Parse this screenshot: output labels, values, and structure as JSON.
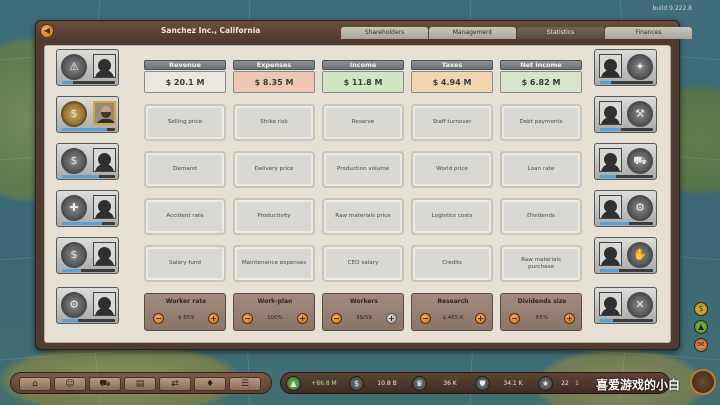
{
  "version": "build 9.222.8",
  "window": {
    "title": "Sanchez Inc., California",
    "close_icon": "back-arrow-icon"
  },
  "tabs": [
    {
      "label": "Shareholders",
      "active": false
    },
    {
      "label": "Management",
      "active": false
    },
    {
      "label": "Statistics",
      "active": true
    },
    {
      "label": "Finances",
      "active": false
    }
  ],
  "headers": [
    {
      "label": "Revenue",
      "value": "$ 20.1 M"
    },
    {
      "label": "Expenses",
      "value": "$ 8.35 M"
    },
    {
      "label": "Income",
      "value": "$ 11.8 M"
    },
    {
      "label": "Taxes",
      "value": "$ 4.94 M"
    },
    {
      "label": "Net income",
      "value": "$ 6.82 M"
    }
  ],
  "factors": [
    [
      "Selling price",
      "Strike risk",
      "Reserve",
      "Staff turnover",
      "Debt payments"
    ],
    [
      "Demand",
      "Delivery price",
      "Production volume",
      "World price",
      "Loan rate"
    ],
    [
      "Accident rate",
      "Productivity",
      "Raw materials price",
      "Logistics costs",
      "Dividends"
    ],
    [
      "Salary fund",
      "Maintenance expenses",
      "CEO salary",
      "Credits",
      "Raw materials purchase"
    ]
  ],
  "controls": [
    {
      "label": "Worker rate",
      "value": "$ 659"
    },
    {
      "label": "Work-plan",
      "value": "100%"
    },
    {
      "label": "Workers",
      "value": "39/59"
    },
    {
      "label": "Research",
      "value": "$ 465 K"
    },
    {
      "label": "Dividends size",
      "value": "65%"
    }
  ],
  "left_cards": [
    {
      "icon": "hazard-gear-icon",
      "hired": false,
      "fill": 0.2
    },
    {
      "icon": "chart-gear-icon",
      "hired": true,
      "fill": 0.85
    },
    {
      "icon": "money-gear-icon",
      "hired": false,
      "fill": 0.7
    },
    {
      "icon": "safety-gear-icon",
      "hired": false,
      "fill": 0.75
    },
    {
      "icon": "finance-gear-icon",
      "hired": false,
      "fill": 0.35
    },
    {
      "icon": "research-gear-icon",
      "hired": false,
      "fill": 0.3
    }
  ],
  "right_cards": [
    {
      "icon": "compass-gear-icon",
      "fill": 0.2
    },
    {
      "icon": "wrench-gear-icon",
      "fill": 0.4
    },
    {
      "icon": "truck-gear-icon",
      "fill": 0.3
    },
    {
      "icon": "tools-gear-icon",
      "fill": 0.55
    },
    {
      "icon": "sales-gear-icon",
      "fill": 0.35
    },
    {
      "icon": "hammer-wrench-gear-icon",
      "fill": 0.25
    }
  ],
  "taskbar": [
    "factory-icon",
    "people-icon",
    "transport-icon",
    "storage-icon",
    "handshake-icon",
    "map-pin-icon",
    "menu-icon"
  ],
  "statusbar": {
    "income": "+86.8 M",
    "money": "10.8 B",
    "crown": "36 K",
    "shield": "34.1 K",
    "stars": "22",
    "stars_badge": "1"
  },
  "watermark": "喜爱游戏的小白"
}
